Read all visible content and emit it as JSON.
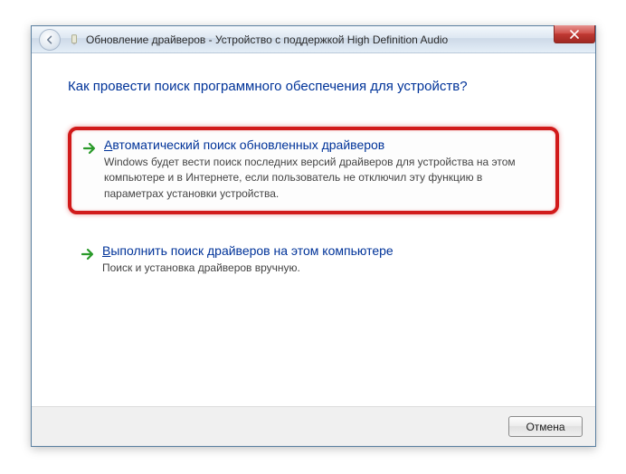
{
  "titlebar": {
    "title": "Обновление драйверов - Устройство с поддержкой High Definition Audio"
  },
  "content": {
    "heading": "Как провести поиск программного обеспечения для устройств?",
    "option1": {
      "title_prefix": "А",
      "title_rest": "втоматический поиск обновленных драйверов",
      "desc": "Windows будет вести поиск последних версий драйверов для устройства на этом компьютере и в Интернете, если пользователь не отключил эту функцию в параметрах установки устройства."
    },
    "option2": {
      "title_prefix": "В",
      "title_rest": "ыполнить поиск драйверов на этом компьютере",
      "desc": "Поиск и установка драйверов вручную."
    }
  },
  "footer": {
    "cancel": "Отмена"
  }
}
